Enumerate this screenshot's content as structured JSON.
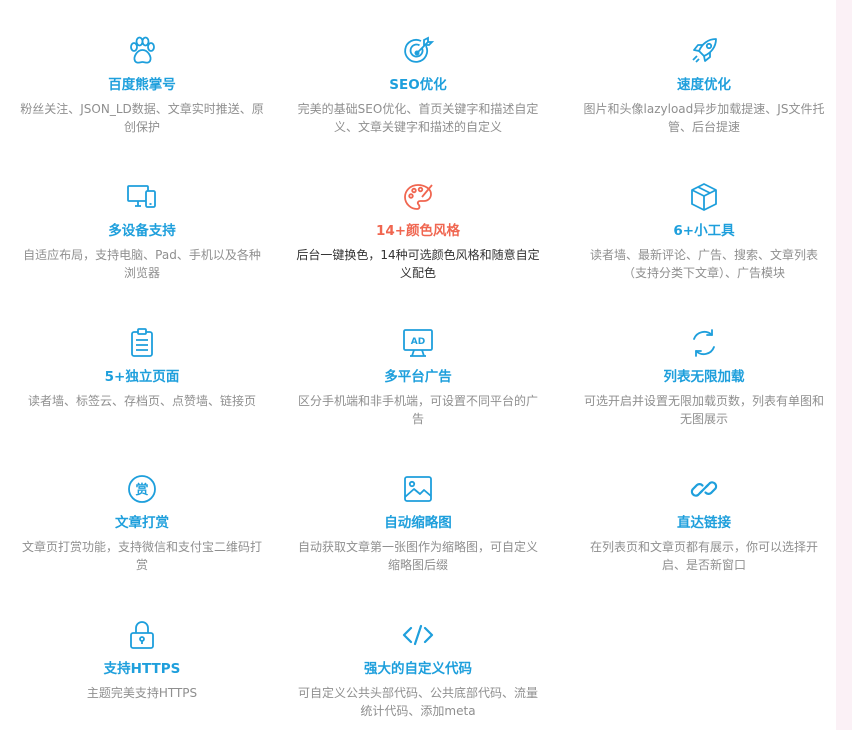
{
  "colors": {
    "title": "#1e9fdc",
    "accent_title": "#f06650",
    "desc": "#8f8f8f",
    "icon": "#1e9fdc",
    "accent_icon": "#f06650"
  },
  "features": [
    {
      "icon": "paw-icon",
      "title": "百度熊掌号",
      "desc": "粉丝关注、JSON_LD数据、文章实时推送、原创保护"
    },
    {
      "icon": "target-icon",
      "title": "SEO优化",
      "desc": "完美的基础SEO优化、首页关键字和描述自定义、文章关键字和描述的自定义"
    },
    {
      "icon": "rocket-icon",
      "title": "速度优化",
      "desc": "图片和头像lazyload异步加载提速、JS文件托管、后台提速"
    },
    {
      "icon": "devices-icon",
      "title": "多设备支持",
      "desc": "自适应布局，支持电脑、Pad、手机以及各种浏览器"
    },
    {
      "icon": "palette-icon",
      "title": "14+颜色风格",
      "desc": "后台一键换色，14种可选颜色风格和随意自定义配色"
    },
    {
      "icon": "cube-icon",
      "title": "6+小工具",
      "desc": "读者墙、最新评论、广告、搜索、文章列表（支持分类下文章）、广告模块"
    },
    {
      "icon": "clipboard-icon",
      "title": "5+独立页面",
      "desc": "读者墙、标签云、存档页、点赞墙、链接页"
    },
    {
      "icon": "ad-icon",
      "title": "多平台广告",
      "desc": "区分手机端和非手机端，可设置不同平台的广告"
    },
    {
      "icon": "refresh-icon",
      "title": "列表无限加载",
      "desc": "可选开启并设置无限加载页数，列表有单图和无图展示"
    },
    {
      "icon": "reward-icon",
      "title": "文章打赏",
      "desc": "文章页打赏功能，支持微信和支付宝二维码打赏"
    },
    {
      "icon": "image-icon",
      "title": "自动缩略图",
      "desc": "自动获取文章第一张图作为缩略图，可自定义缩略图后缀"
    },
    {
      "icon": "link-icon",
      "title": "直达链接",
      "desc": "在列表页和文章页都有展示，你可以选择开启、是否新窗口"
    },
    {
      "icon": "lock-icon",
      "title": "支持HTTPS",
      "desc": "主题完美支持HTTPS"
    },
    {
      "icon": "code-icon",
      "title": "强大的自定义代码",
      "desc": "可自定义公共头部代码、公共底部代码、流量统计代码、添加meta"
    }
  ]
}
